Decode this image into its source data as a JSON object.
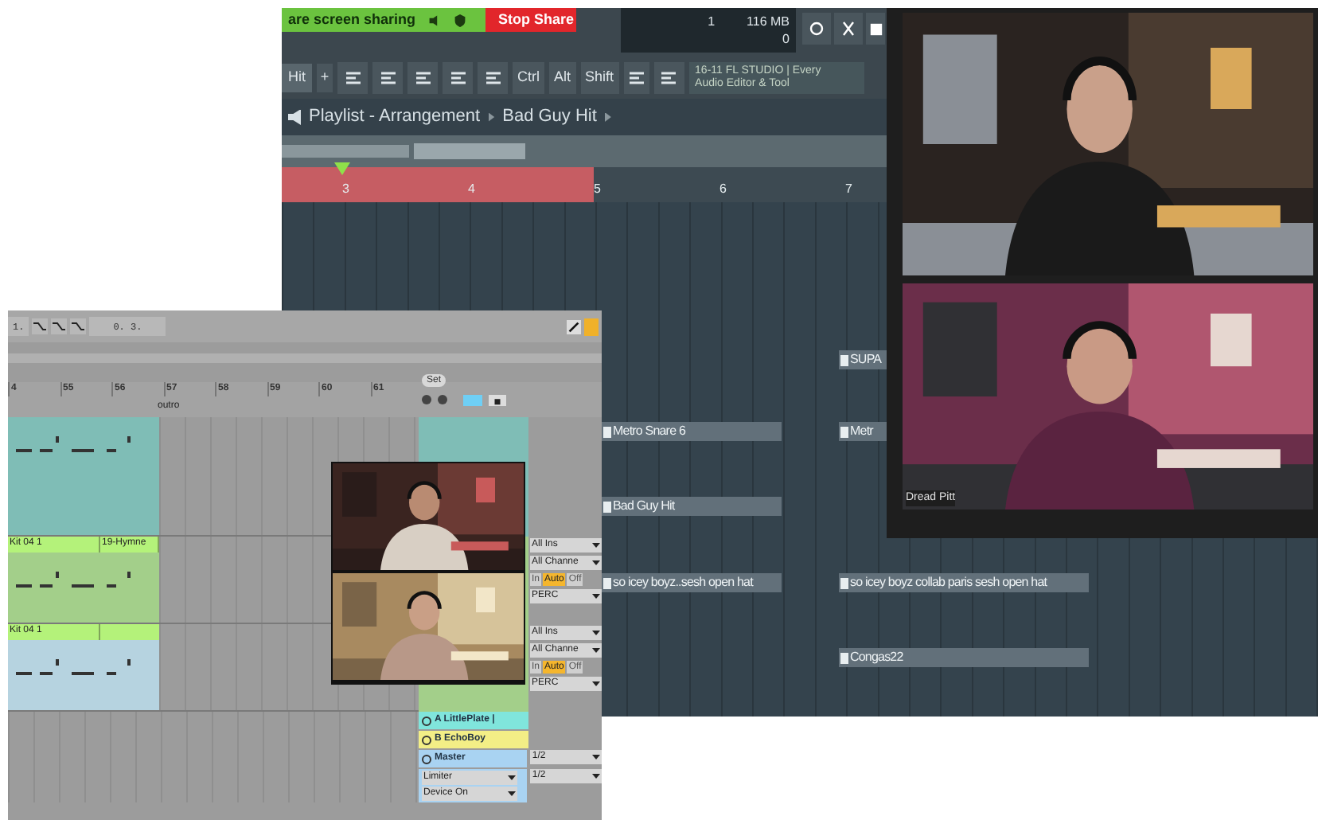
{
  "fl_window": {
    "share_banner": {
      "text": "are screen sharing",
      "stop_button": "Stop Share"
    },
    "meters": {
      "pattern": "1",
      "memory": "116 MB",
      "cpu": "0"
    },
    "toolbar": {
      "pattern_name": "Hit",
      "add": "+",
      "keys": [
        "Ctrl",
        "Alt",
        "Shift"
      ],
      "hint_line1": "16-11 FL STUDIO | Every",
      "hint_line2": "Audio Editor & Tool"
    },
    "breadcrumb": {
      "title": "Playlist - Arrangement",
      "pattern": "Bad Guy Hit"
    },
    "ruler": {
      "bars": [
        "3",
        "4",
        "5",
        "6",
        "7"
      ]
    },
    "clips": [
      {
        "label": "SUPA"
      },
      {
        "label": "Metro Snare 6"
      },
      {
        "label": "Metr"
      },
      {
        "label": "Bad Guy Hit"
      },
      {
        "label": "so icey boyz..sesh open hat"
      },
      {
        "label": "so icey boyz collab paris sesh open hat"
      },
      {
        "label": "Congas22"
      }
    ]
  },
  "video_call": {
    "participants": [
      {
        "kind": "picture"
      },
      {
        "kind": "picture",
        "name": "Dread Pitt"
      }
    ]
  },
  "ableton": {
    "position_start": "1.",
    "position_end": "0. 3.",
    "bars": [
      "4",
      "55",
      "56",
      "57",
      "58",
      "59",
      "60",
      "61"
    ],
    "locator": "outro",
    "set_button": "Set",
    "tracks": [
      {
        "color": "#7fbdb6"
      },
      {
        "color": "#a3cf8a",
        "clips": [
          "Kit 04 1",
          "19-Hymne"
        ]
      },
      {
        "color": "#b6d3e0",
        "clips": [
          "Kit 04 1"
        ]
      }
    ],
    "mixer": [
      {
        "input": "All Ins",
        "channel": "All Channe",
        "monitor": [
          {
            "label": "In",
            "selected": false
          },
          {
            "label": "Auto",
            "selected": true
          },
          {
            "label": "Off",
            "selected": false
          }
        ],
        "output": "PERC"
      },
      {
        "input": "All Ins",
        "channel": "All Channe",
        "monitor": [
          {
            "label": "In",
            "selected": false
          },
          {
            "label": "Auto",
            "selected": true
          },
          {
            "label": "Off",
            "selected": false
          }
        ],
        "output": "PERC"
      }
    ],
    "returns": [
      {
        "label": "A LittlePlate |",
        "color": "#80e5dc"
      },
      {
        "label": "B EchoBoy",
        "color": "#f3ee86"
      },
      {
        "label": "Master",
        "color": "#a9d3f2"
      }
    ],
    "master_devices": [
      "Limiter",
      "Device On"
    ],
    "outputs": [
      "1/2",
      "1/2"
    ]
  }
}
